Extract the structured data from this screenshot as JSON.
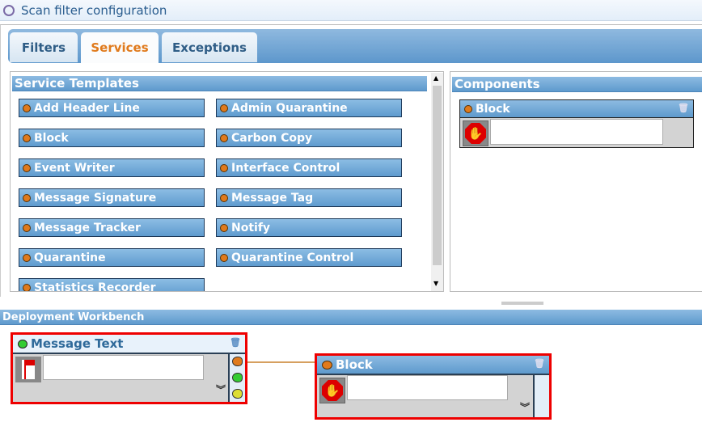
{
  "window": {
    "title": "Scan filter configuration"
  },
  "tabs": [
    {
      "label": "Filters"
    },
    {
      "label": "Services"
    },
    {
      "label": "Exceptions"
    }
  ],
  "active_tab": "Services",
  "templates": {
    "title": "Service  Templates",
    "items": [
      {
        "label": "Add Header Line"
      },
      {
        "label": "Admin Quarantine"
      },
      {
        "label": "Block"
      },
      {
        "label": "Carbon Copy"
      },
      {
        "label": "Event Writer"
      },
      {
        "label": "Interface Control"
      },
      {
        "label": "Message Signature"
      },
      {
        "label": "Message Tag"
      },
      {
        "label": "Message Tracker"
      },
      {
        "label": "Notify"
      },
      {
        "label": "Quarantine"
      },
      {
        "label": "Quarantine Control"
      },
      {
        "label": "Statistics Recorder"
      }
    ]
  },
  "components": {
    "title": "Components",
    "items": [
      {
        "label": "Block",
        "text": ""
      }
    ]
  },
  "workbench": {
    "title": "Deployment Workbench",
    "nodes": [
      {
        "label": "Message Text",
        "text": ""
      },
      {
        "label": "Block",
        "text": ""
      }
    ]
  },
  "colors": {
    "accent": "#e07a1c",
    "header": "#5e9acd",
    "selection": "#e00000"
  }
}
